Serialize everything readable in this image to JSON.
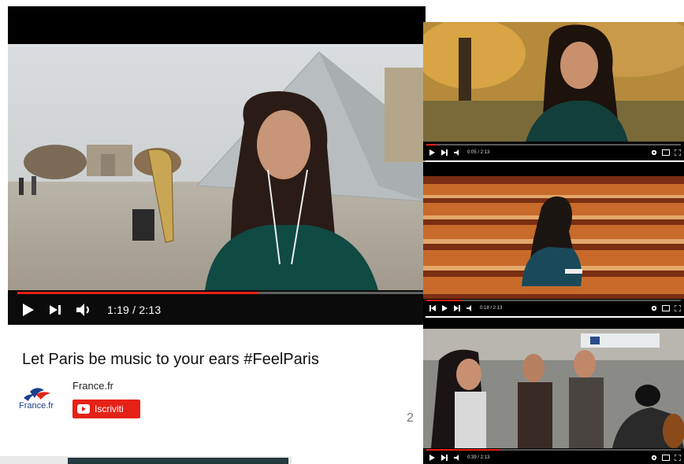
{
  "main_player": {
    "time_display": "1:19 / 2:13",
    "progress": 0.59,
    "buttons": {
      "play": "play",
      "next": "next",
      "volume": "volume"
    }
  },
  "video": {
    "title": "Let Paris be music to your ears #FeelParis"
  },
  "channel": {
    "name": "France.fr",
    "logo_text": "France.fr",
    "subscribe_label": "Iscriviti"
  },
  "partial_count": "2",
  "side_videos": [
    {
      "time_display": "0:05 / 2:13",
      "progress": 0.04
    },
    {
      "time_display": "0:18 / 2:13",
      "progress": 0.14
    },
    {
      "time_display": "0:39 / 2:13",
      "progress": 0.29
    }
  ],
  "colors": {
    "accent": "#e62117",
    "control_bg": "#0b0b0b"
  }
}
